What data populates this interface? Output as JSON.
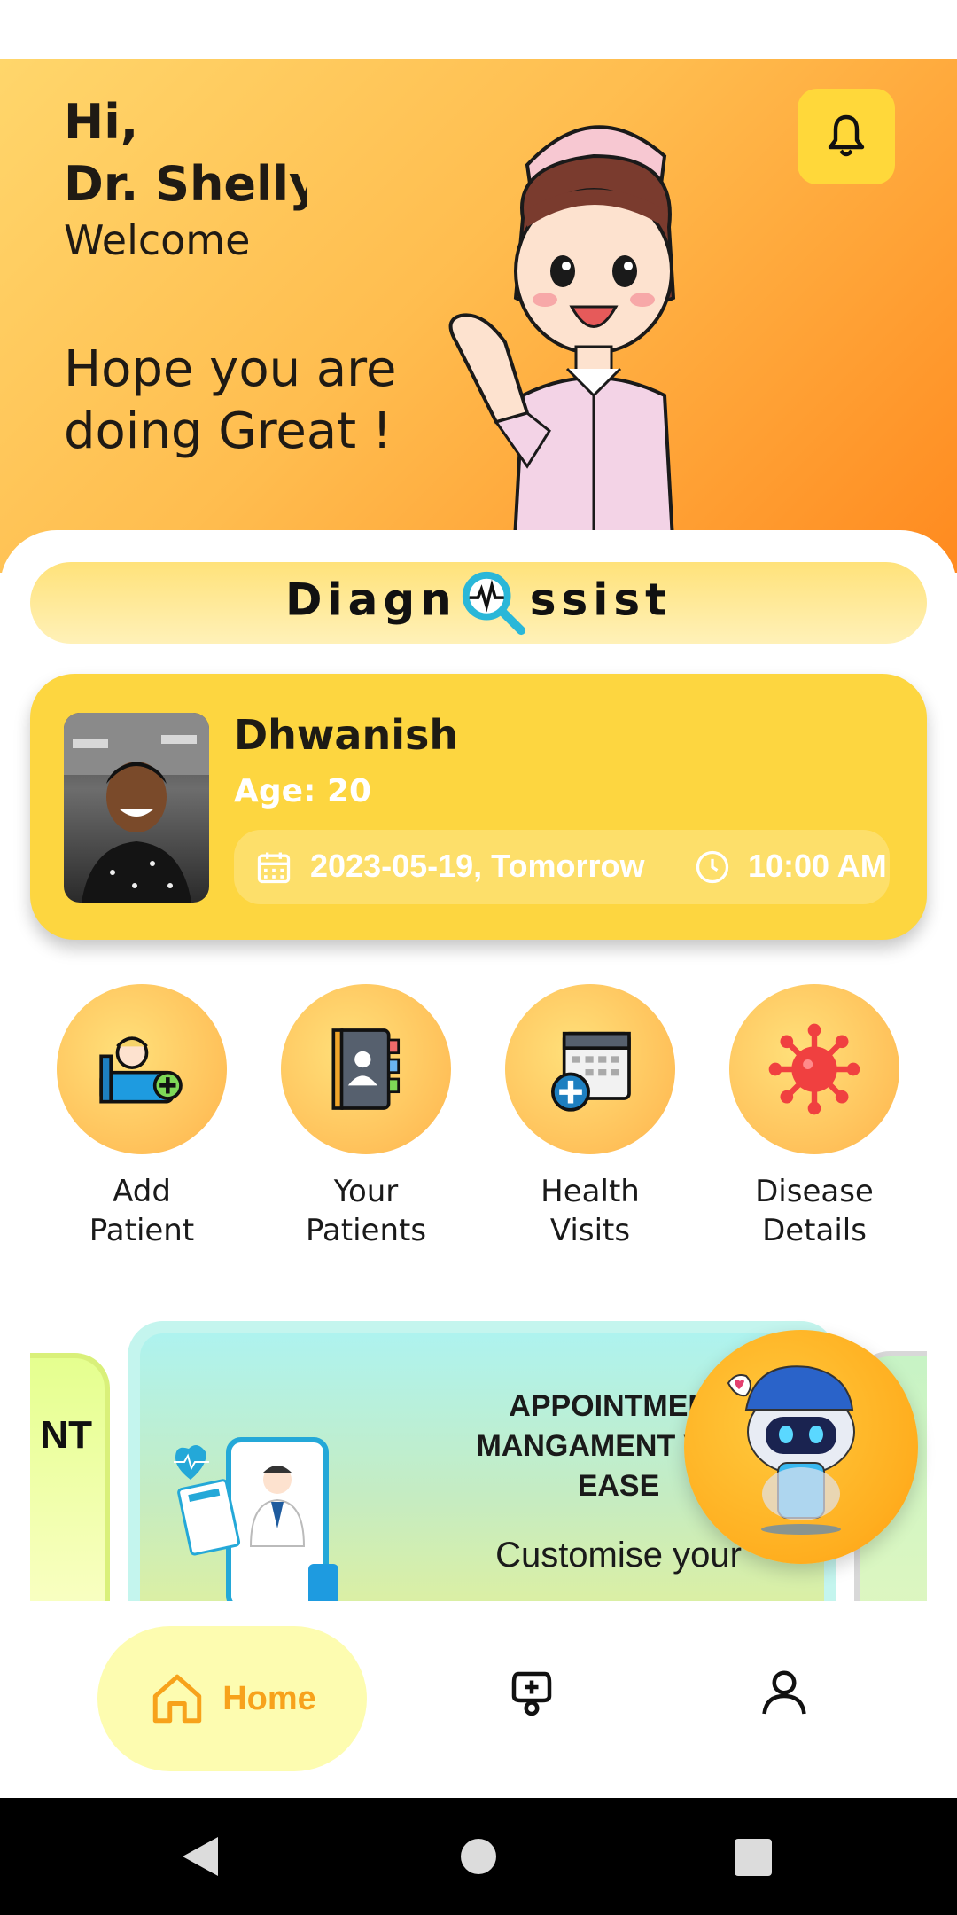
{
  "header": {
    "hi": "Hi,",
    "doctor_name": "Dr. Shelly A",
    "welcome": "Welcome",
    "message": "Hope you are doing Great !",
    "bell_icon": "bell-icon"
  },
  "brand": {
    "part1": "Diagn",
    "part2": "ssist",
    "icon": "magnifier-heartbeat-icon"
  },
  "appointment": {
    "patient_name": "Dhwanish",
    "age": "Age: 20",
    "date": "2023-05-19, Tomorrow",
    "time": "10:00 AM",
    "card_color": "#fdd640"
  },
  "quick_actions": [
    {
      "label_line1": "Add",
      "label_line2": "Patient",
      "icon": "add-patient-icon"
    },
    {
      "label_line1": "Your",
      "label_line2": "Patients",
      "icon": "patients-book-icon"
    },
    {
      "label_line1": "Health",
      "label_line2": "Visits",
      "icon": "calendar-plus-icon"
    },
    {
      "label_line1": "Disease",
      "label_line2": "Details",
      "icon": "virus-icon"
    }
  ],
  "carousel": {
    "left_slide_text": "NT",
    "main_title_l1": "APPOINTMENT",
    "main_title_l2": "MANGAMENT WITH",
    "main_title_l3": "EASE",
    "main_subtitle": "Customise your"
  },
  "bottom_nav": {
    "home_label": "Home",
    "accent": "#f7a21b",
    "items": [
      "home-icon",
      "doctor-bag-icon",
      "profile-icon"
    ]
  }
}
